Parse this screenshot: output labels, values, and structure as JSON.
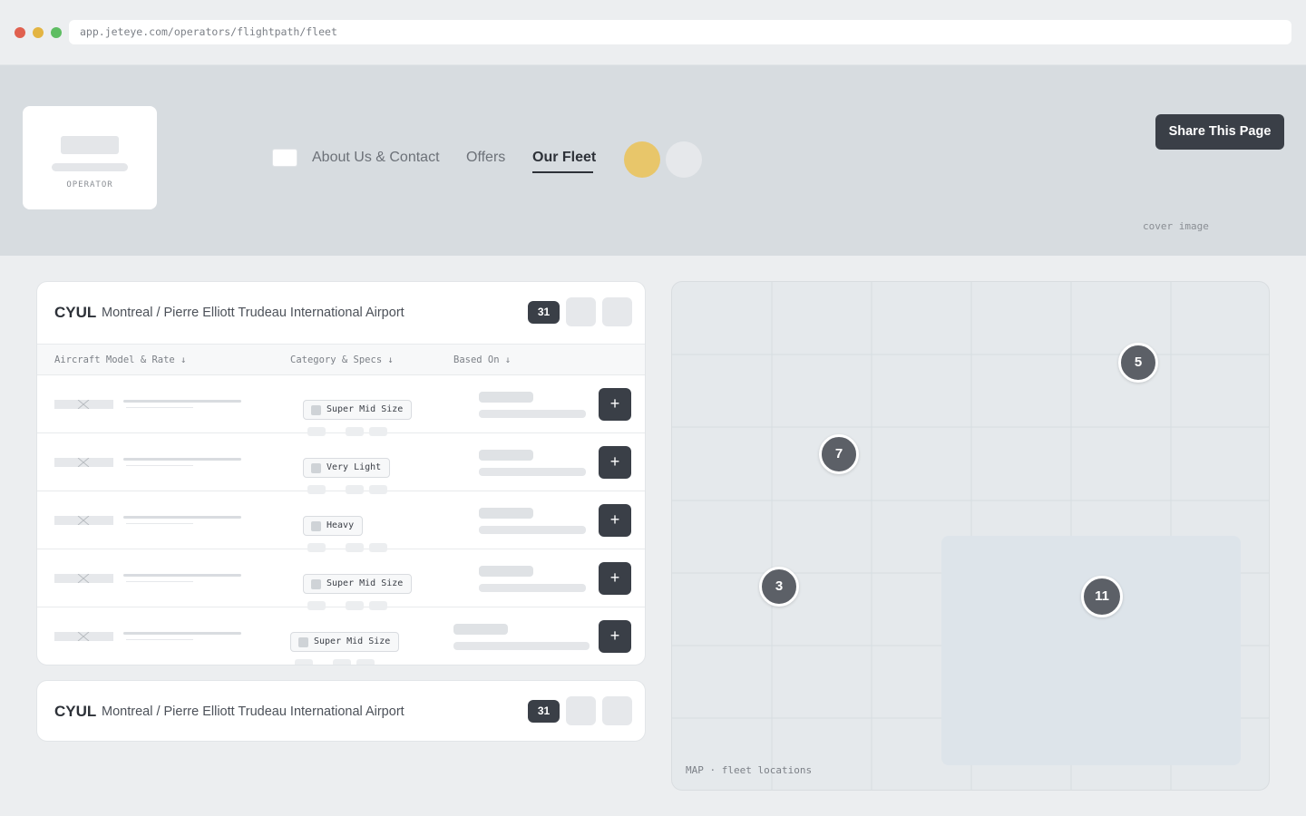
{
  "browser": {
    "url": "app.jeteye.com/operators/flightpath/fleet"
  },
  "header": {
    "logo_label": "OPERATOR",
    "nav": [
      {
        "label": "About Us & Contact"
      },
      {
        "label": "Offers"
      },
      {
        "label": "Our Fleet",
        "active": true
      }
    ],
    "share_label": "Share This Page",
    "cover_label": "cover image"
  },
  "fleet_card": {
    "code": "CYUL",
    "airport": "Montreal / Pierre Elliott Trudeau International Airport",
    "count": "31",
    "columns": [
      "Aircraft Model & Rate ↓",
      "Category & Specs ↓",
      "Based On ↓"
    ],
    "rows": [
      {
        "category": "Super Mid Size"
      },
      {
        "category": "Very Light"
      },
      {
        "category": "Heavy"
      },
      {
        "category": "Super Mid Size"
      },
      {
        "category": "Super Mid Size"
      }
    ],
    "add_label": "+"
  },
  "fleet_card_2": {
    "code": "CYUL",
    "airport": "Montreal / Pierre Elliott Trudeau International Airport",
    "count": "31"
  },
  "map": {
    "label": "MAP · fleet locations",
    "markers": [
      "5",
      "7",
      "3",
      "11"
    ]
  },
  "colors": {
    "accent_dark": "#3a3f47",
    "accent_yellow": "#e8c66a"
  }
}
